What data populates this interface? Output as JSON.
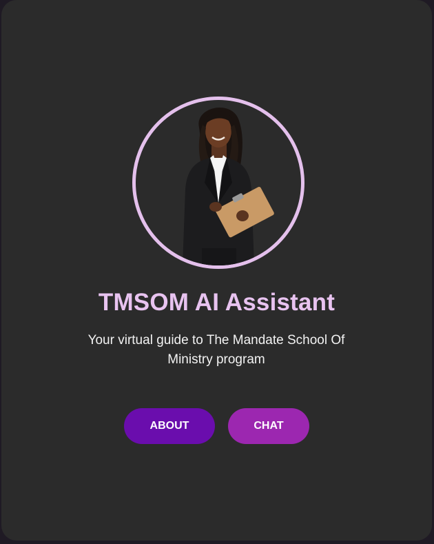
{
  "assistant": {
    "title": "TMSOM AI Assistant",
    "subtitle": "Your virtual guide to The Mandate School Of Ministry program",
    "avatar_icon": "businesswoman-with-clipboard-avatar"
  },
  "buttons": {
    "about_label": "ABOUT",
    "chat_label": "CHAT"
  },
  "colors": {
    "card_background": "#2b2b2b",
    "accent_pink": "#e8c3f0",
    "about_button": "#6a0dad",
    "chat_button": "#9c27b0"
  }
}
